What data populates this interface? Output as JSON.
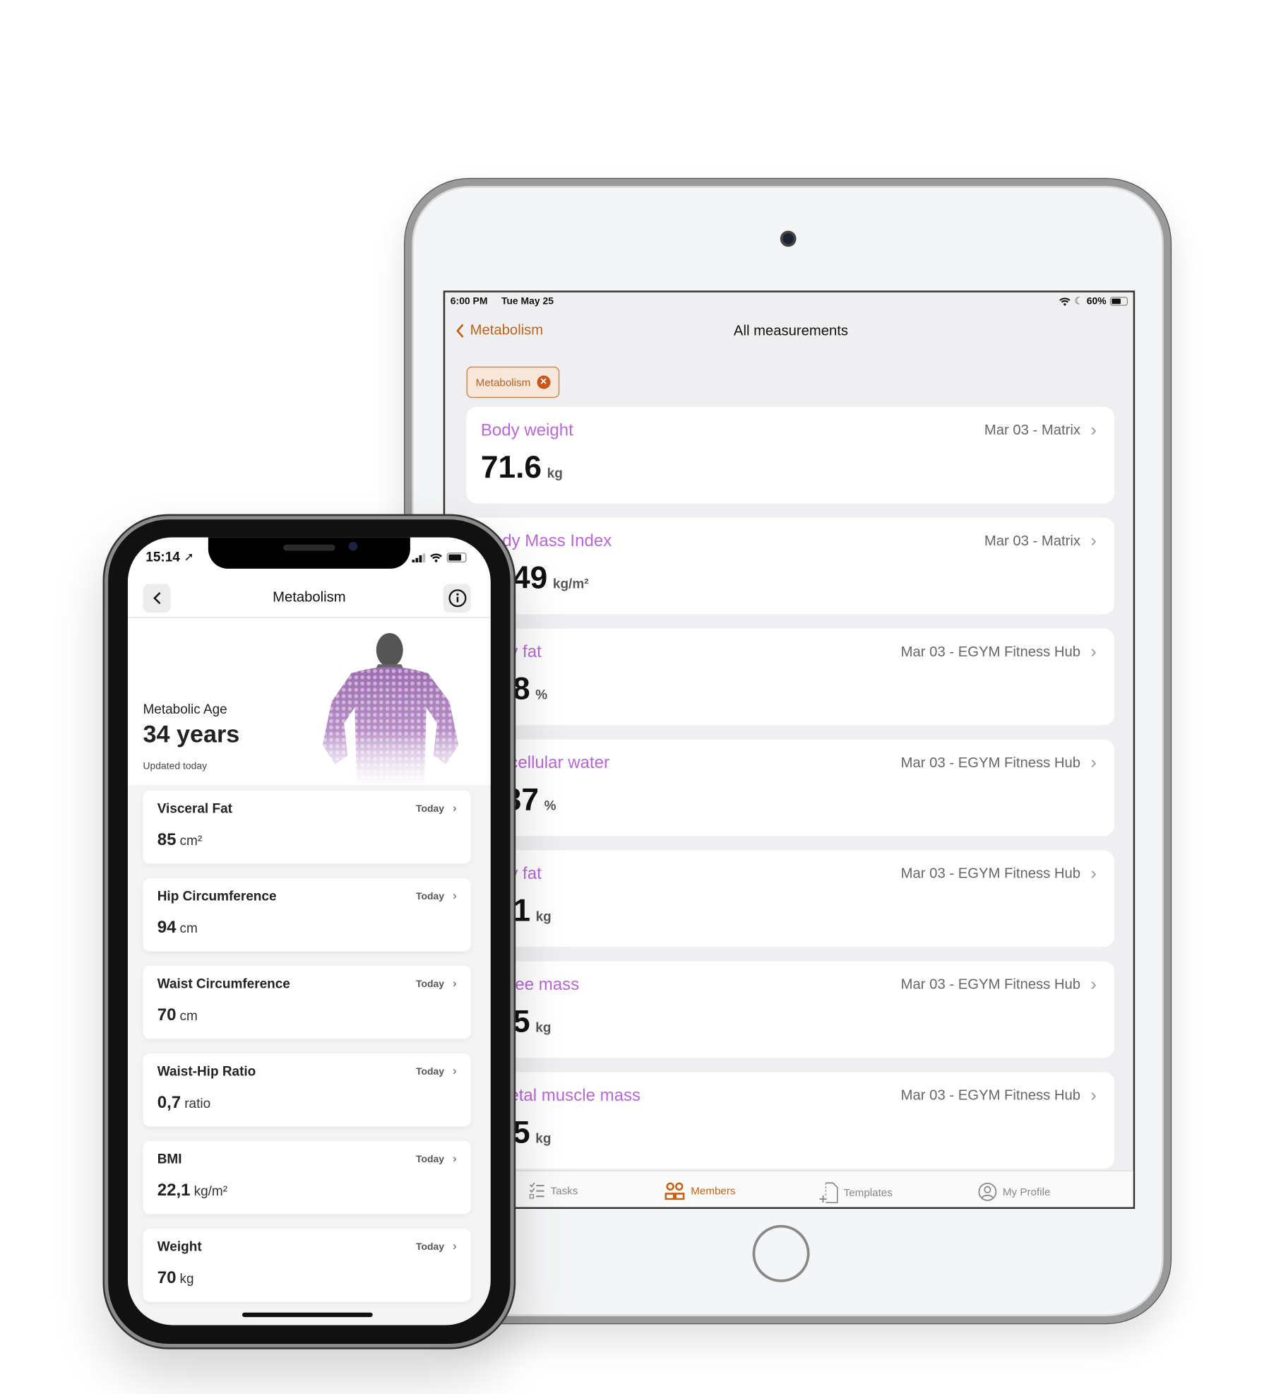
{
  "tablet": {
    "status": {
      "time": "6:00 PM",
      "date": "Tue May 25",
      "battery": "60%"
    },
    "nav": {
      "back_label": "Metabolism",
      "title": "All measurements"
    },
    "filter_chip": {
      "label": "Metabolism"
    },
    "measurements": [
      {
        "title": "Body weight",
        "value": "71.6",
        "unit": "kg",
        "source": "Mar 03 - Matrix"
      },
      {
        "title": "dy Mass Index",
        "value": ".49",
        "unit": "kg/m²",
        "source": "Mar 03 - Matrix"
      },
      {
        "title": "y fat",
        "value": ".8",
        "unit": "%",
        "source": "Mar 03 - EGYM Fitness Hub"
      },
      {
        "title": "cellular water",
        "value": "37",
        "unit": "%",
        "source": "Mar 03 - EGYM Fitness Hub"
      },
      {
        "title": "y fat",
        "value": "1",
        "unit": "kg",
        "source": "Mar 03 - EGYM Fitness Hub"
      },
      {
        "title": "ree mass",
        "value": ".5",
        "unit": "kg",
        "source": "Mar 03 - EGYM Fitness Hub"
      },
      {
        "title": "etal muscle mass",
        "value": ".5",
        "unit": "kg",
        "source": "Mar 03 - EGYM Fitness Hub"
      }
    ],
    "tabs": [
      {
        "label": "Tasks",
        "icon": "checklist-icon",
        "active": false
      },
      {
        "label": "Members",
        "icon": "members-icon",
        "active": true
      },
      {
        "label": "Templates",
        "icon": "template-icon",
        "active": false
      },
      {
        "label": "My Profile",
        "icon": "profile-icon",
        "active": false
      }
    ],
    "colors": {
      "accent": "#c0631b",
      "metric_title": "#b968d4"
    }
  },
  "phone": {
    "status": {
      "time": "15:14"
    },
    "nav": {
      "title": "Metabolism"
    },
    "hero": {
      "label": "Metabolic Age",
      "value": "34 years",
      "updated": "Updated today"
    },
    "metrics": [
      {
        "title": "Visceral Fat",
        "value": "85",
        "unit": "cm²",
        "date": "Today"
      },
      {
        "title": "Hip Circumference",
        "value": "94",
        "unit": "cm",
        "date": "Today"
      },
      {
        "title": "Waist Circumference",
        "value": "70",
        "unit": "cm",
        "date": "Today"
      },
      {
        "title": "Waist-Hip Ratio",
        "value": "0,7",
        "unit": "ratio",
        "date": "Today"
      },
      {
        "title": "BMI",
        "value": "22,1",
        "unit": "kg/m²",
        "date": "Today"
      },
      {
        "title": "Weight",
        "value": "70",
        "unit": "kg",
        "date": "Today"
      }
    ]
  }
}
